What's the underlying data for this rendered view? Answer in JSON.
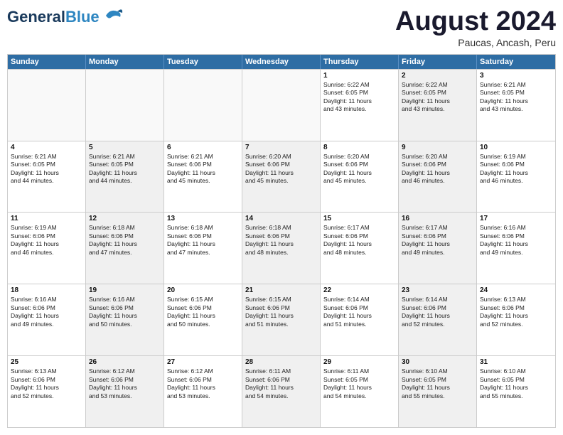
{
  "header": {
    "logo_general": "General",
    "logo_blue": "Blue",
    "month_title": "August 2024",
    "subtitle": "Paucas, Ancash, Peru"
  },
  "calendar": {
    "days_of_week": [
      "Sunday",
      "Monday",
      "Tuesday",
      "Wednesday",
      "Thursday",
      "Friday",
      "Saturday"
    ],
    "weeks": [
      [
        {
          "day": "",
          "info": "",
          "empty": true
        },
        {
          "day": "",
          "info": "",
          "empty": true
        },
        {
          "day": "",
          "info": "",
          "empty": true
        },
        {
          "day": "",
          "info": "",
          "empty": true
        },
        {
          "day": "1",
          "info": "Sunrise: 6:22 AM\nSunset: 6:05 PM\nDaylight: 11 hours\nand 43 minutes."
        },
        {
          "day": "2",
          "info": "Sunrise: 6:22 AM\nSunset: 6:05 PM\nDaylight: 11 hours\nand 43 minutes.",
          "shaded": true
        },
        {
          "day": "3",
          "info": "Sunrise: 6:21 AM\nSunset: 6:05 PM\nDaylight: 11 hours\nand 43 minutes."
        }
      ],
      [
        {
          "day": "4",
          "info": "Sunrise: 6:21 AM\nSunset: 6:05 PM\nDaylight: 11 hours\nand 44 minutes."
        },
        {
          "day": "5",
          "info": "Sunrise: 6:21 AM\nSunset: 6:05 PM\nDaylight: 11 hours\nand 44 minutes.",
          "shaded": true
        },
        {
          "day": "6",
          "info": "Sunrise: 6:21 AM\nSunset: 6:06 PM\nDaylight: 11 hours\nand 45 minutes."
        },
        {
          "day": "7",
          "info": "Sunrise: 6:20 AM\nSunset: 6:06 PM\nDaylight: 11 hours\nand 45 minutes.",
          "shaded": true
        },
        {
          "day": "8",
          "info": "Sunrise: 6:20 AM\nSunset: 6:06 PM\nDaylight: 11 hours\nand 45 minutes."
        },
        {
          "day": "9",
          "info": "Sunrise: 6:20 AM\nSunset: 6:06 PM\nDaylight: 11 hours\nand 46 minutes.",
          "shaded": true
        },
        {
          "day": "10",
          "info": "Sunrise: 6:19 AM\nSunset: 6:06 PM\nDaylight: 11 hours\nand 46 minutes."
        }
      ],
      [
        {
          "day": "11",
          "info": "Sunrise: 6:19 AM\nSunset: 6:06 PM\nDaylight: 11 hours\nand 46 minutes."
        },
        {
          "day": "12",
          "info": "Sunrise: 6:18 AM\nSunset: 6:06 PM\nDaylight: 11 hours\nand 47 minutes.",
          "shaded": true
        },
        {
          "day": "13",
          "info": "Sunrise: 6:18 AM\nSunset: 6:06 PM\nDaylight: 11 hours\nand 47 minutes."
        },
        {
          "day": "14",
          "info": "Sunrise: 6:18 AM\nSunset: 6:06 PM\nDaylight: 11 hours\nand 48 minutes.",
          "shaded": true
        },
        {
          "day": "15",
          "info": "Sunrise: 6:17 AM\nSunset: 6:06 PM\nDaylight: 11 hours\nand 48 minutes."
        },
        {
          "day": "16",
          "info": "Sunrise: 6:17 AM\nSunset: 6:06 PM\nDaylight: 11 hours\nand 49 minutes.",
          "shaded": true
        },
        {
          "day": "17",
          "info": "Sunrise: 6:16 AM\nSunset: 6:06 PM\nDaylight: 11 hours\nand 49 minutes."
        }
      ],
      [
        {
          "day": "18",
          "info": "Sunrise: 6:16 AM\nSunset: 6:06 PM\nDaylight: 11 hours\nand 49 minutes."
        },
        {
          "day": "19",
          "info": "Sunrise: 6:16 AM\nSunset: 6:06 PM\nDaylight: 11 hours\nand 50 minutes.",
          "shaded": true
        },
        {
          "day": "20",
          "info": "Sunrise: 6:15 AM\nSunset: 6:06 PM\nDaylight: 11 hours\nand 50 minutes."
        },
        {
          "day": "21",
          "info": "Sunrise: 6:15 AM\nSunset: 6:06 PM\nDaylight: 11 hours\nand 51 minutes.",
          "shaded": true
        },
        {
          "day": "22",
          "info": "Sunrise: 6:14 AM\nSunset: 6:06 PM\nDaylight: 11 hours\nand 51 minutes."
        },
        {
          "day": "23",
          "info": "Sunrise: 6:14 AM\nSunset: 6:06 PM\nDaylight: 11 hours\nand 52 minutes.",
          "shaded": true
        },
        {
          "day": "24",
          "info": "Sunrise: 6:13 AM\nSunset: 6:06 PM\nDaylight: 11 hours\nand 52 minutes."
        }
      ],
      [
        {
          "day": "25",
          "info": "Sunrise: 6:13 AM\nSunset: 6:06 PM\nDaylight: 11 hours\nand 52 minutes."
        },
        {
          "day": "26",
          "info": "Sunrise: 6:12 AM\nSunset: 6:06 PM\nDaylight: 11 hours\nand 53 minutes.",
          "shaded": true
        },
        {
          "day": "27",
          "info": "Sunrise: 6:12 AM\nSunset: 6:06 PM\nDaylight: 11 hours\nand 53 minutes."
        },
        {
          "day": "28",
          "info": "Sunrise: 6:11 AM\nSunset: 6:06 PM\nDaylight: 11 hours\nand 54 minutes.",
          "shaded": true
        },
        {
          "day": "29",
          "info": "Sunrise: 6:11 AM\nSunset: 6:05 PM\nDaylight: 11 hours\nand 54 minutes."
        },
        {
          "day": "30",
          "info": "Sunrise: 6:10 AM\nSunset: 6:05 PM\nDaylight: 11 hours\nand 55 minutes.",
          "shaded": true
        },
        {
          "day": "31",
          "info": "Sunrise: 6:10 AM\nSunset: 6:05 PM\nDaylight: 11 hours\nand 55 minutes."
        }
      ]
    ]
  }
}
